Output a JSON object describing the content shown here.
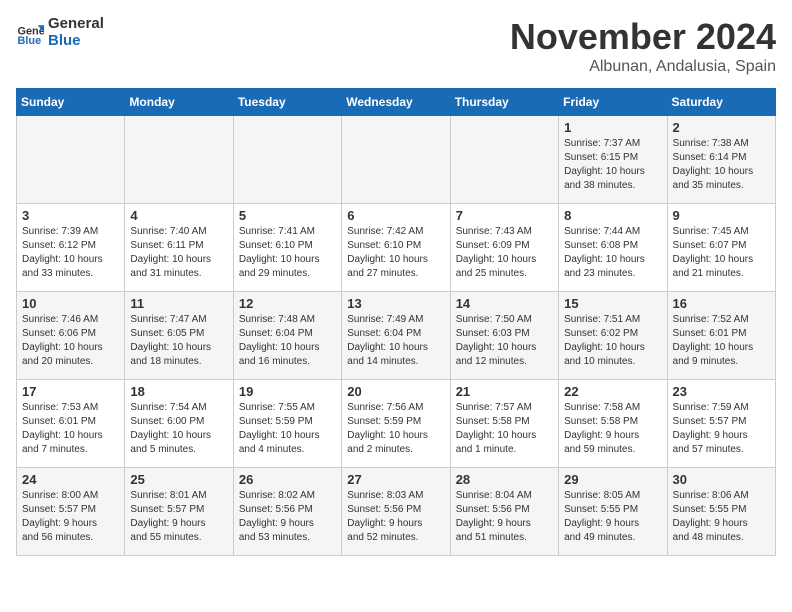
{
  "logo": {
    "line1": "General",
    "line2": "Blue"
  },
  "title": "November 2024",
  "location": "Albunan, Andalusia, Spain",
  "weekdays": [
    "Sunday",
    "Monday",
    "Tuesday",
    "Wednesday",
    "Thursday",
    "Friday",
    "Saturday"
  ],
  "weeks": [
    [
      {
        "day": "",
        "info": ""
      },
      {
        "day": "",
        "info": ""
      },
      {
        "day": "",
        "info": ""
      },
      {
        "day": "",
        "info": ""
      },
      {
        "day": "",
        "info": ""
      },
      {
        "day": "1",
        "info": "Sunrise: 7:37 AM\nSunset: 6:15 PM\nDaylight: 10 hours\nand 38 minutes."
      },
      {
        "day": "2",
        "info": "Sunrise: 7:38 AM\nSunset: 6:14 PM\nDaylight: 10 hours\nand 35 minutes."
      }
    ],
    [
      {
        "day": "3",
        "info": "Sunrise: 7:39 AM\nSunset: 6:12 PM\nDaylight: 10 hours\nand 33 minutes."
      },
      {
        "day": "4",
        "info": "Sunrise: 7:40 AM\nSunset: 6:11 PM\nDaylight: 10 hours\nand 31 minutes."
      },
      {
        "day": "5",
        "info": "Sunrise: 7:41 AM\nSunset: 6:10 PM\nDaylight: 10 hours\nand 29 minutes."
      },
      {
        "day": "6",
        "info": "Sunrise: 7:42 AM\nSunset: 6:10 PM\nDaylight: 10 hours\nand 27 minutes."
      },
      {
        "day": "7",
        "info": "Sunrise: 7:43 AM\nSunset: 6:09 PM\nDaylight: 10 hours\nand 25 minutes."
      },
      {
        "day": "8",
        "info": "Sunrise: 7:44 AM\nSunset: 6:08 PM\nDaylight: 10 hours\nand 23 minutes."
      },
      {
        "day": "9",
        "info": "Sunrise: 7:45 AM\nSunset: 6:07 PM\nDaylight: 10 hours\nand 21 minutes."
      }
    ],
    [
      {
        "day": "10",
        "info": "Sunrise: 7:46 AM\nSunset: 6:06 PM\nDaylight: 10 hours\nand 20 minutes."
      },
      {
        "day": "11",
        "info": "Sunrise: 7:47 AM\nSunset: 6:05 PM\nDaylight: 10 hours\nand 18 minutes."
      },
      {
        "day": "12",
        "info": "Sunrise: 7:48 AM\nSunset: 6:04 PM\nDaylight: 10 hours\nand 16 minutes."
      },
      {
        "day": "13",
        "info": "Sunrise: 7:49 AM\nSunset: 6:04 PM\nDaylight: 10 hours\nand 14 minutes."
      },
      {
        "day": "14",
        "info": "Sunrise: 7:50 AM\nSunset: 6:03 PM\nDaylight: 10 hours\nand 12 minutes."
      },
      {
        "day": "15",
        "info": "Sunrise: 7:51 AM\nSunset: 6:02 PM\nDaylight: 10 hours\nand 10 minutes."
      },
      {
        "day": "16",
        "info": "Sunrise: 7:52 AM\nSunset: 6:01 PM\nDaylight: 10 hours\nand 9 minutes."
      }
    ],
    [
      {
        "day": "17",
        "info": "Sunrise: 7:53 AM\nSunset: 6:01 PM\nDaylight: 10 hours\nand 7 minutes."
      },
      {
        "day": "18",
        "info": "Sunrise: 7:54 AM\nSunset: 6:00 PM\nDaylight: 10 hours\nand 5 minutes."
      },
      {
        "day": "19",
        "info": "Sunrise: 7:55 AM\nSunset: 5:59 PM\nDaylight: 10 hours\nand 4 minutes."
      },
      {
        "day": "20",
        "info": "Sunrise: 7:56 AM\nSunset: 5:59 PM\nDaylight: 10 hours\nand 2 minutes."
      },
      {
        "day": "21",
        "info": "Sunrise: 7:57 AM\nSunset: 5:58 PM\nDaylight: 10 hours\nand 1 minute."
      },
      {
        "day": "22",
        "info": "Sunrise: 7:58 AM\nSunset: 5:58 PM\nDaylight: 9 hours\nand 59 minutes."
      },
      {
        "day": "23",
        "info": "Sunrise: 7:59 AM\nSunset: 5:57 PM\nDaylight: 9 hours\nand 57 minutes."
      }
    ],
    [
      {
        "day": "24",
        "info": "Sunrise: 8:00 AM\nSunset: 5:57 PM\nDaylight: 9 hours\nand 56 minutes."
      },
      {
        "day": "25",
        "info": "Sunrise: 8:01 AM\nSunset: 5:57 PM\nDaylight: 9 hours\nand 55 minutes."
      },
      {
        "day": "26",
        "info": "Sunrise: 8:02 AM\nSunset: 5:56 PM\nDaylight: 9 hours\nand 53 minutes."
      },
      {
        "day": "27",
        "info": "Sunrise: 8:03 AM\nSunset: 5:56 PM\nDaylight: 9 hours\nand 52 minutes."
      },
      {
        "day": "28",
        "info": "Sunrise: 8:04 AM\nSunset: 5:56 PM\nDaylight: 9 hours\nand 51 minutes."
      },
      {
        "day": "29",
        "info": "Sunrise: 8:05 AM\nSunset: 5:55 PM\nDaylight: 9 hours\nand 49 minutes."
      },
      {
        "day": "30",
        "info": "Sunrise: 8:06 AM\nSunset: 5:55 PM\nDaylight: 9 hours\nand 48 minutes."
      }
    ]
  ]
}
